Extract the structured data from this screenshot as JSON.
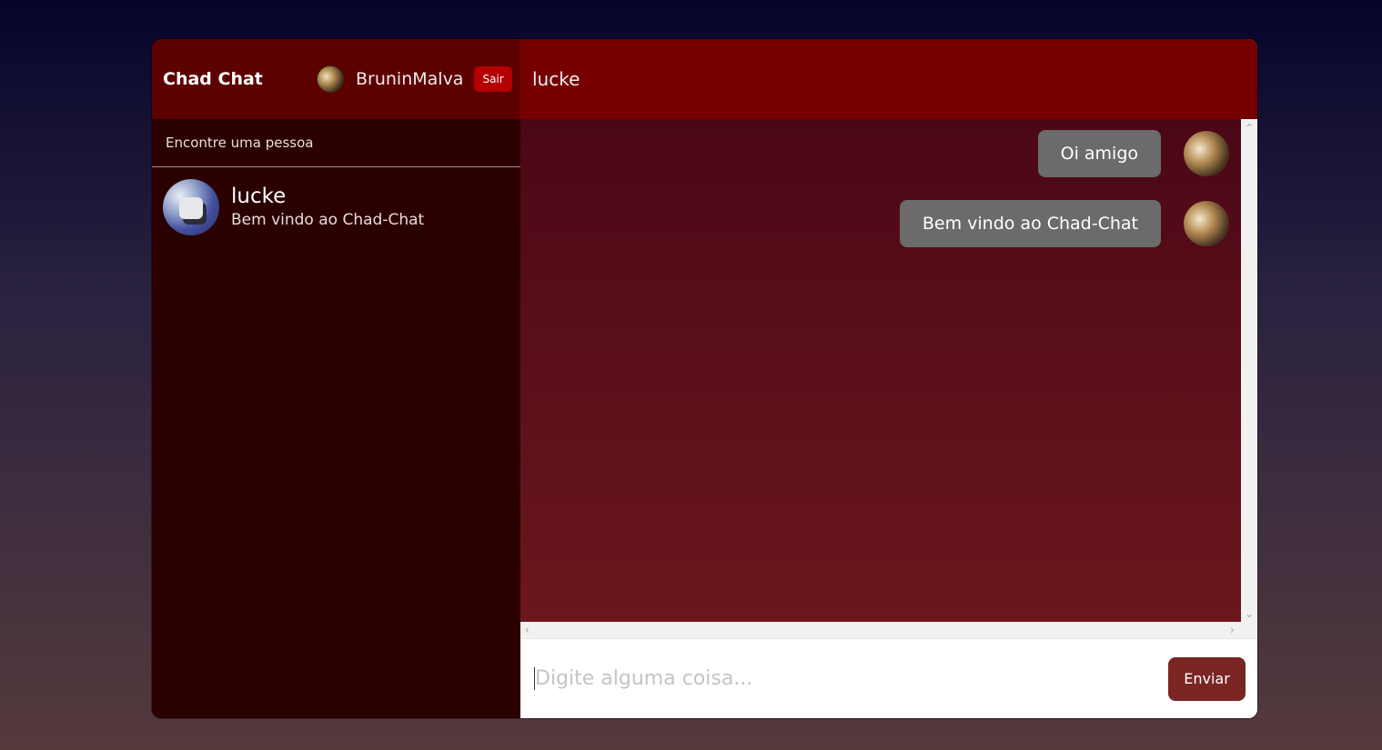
{
  "sidebar": {
    "brand": "Chad Chat",
    "user_name": "BruninMalva",
    "logout_label": "Sair",
    "search_placeholder": "Encontre uma pessoa",
    "contacts": [
      {
        "name": "lucke",
        "last_message": "Bem vindo ao Chad-Chat"
      }
    ]
  },
  "chat": {
    "title": "lucke",
    "messages": [
      {
        "text": "Oi amigo"
      },
      {
        "text": "Bem vindo ao Chad-Chat"
      }
    ],
    "input_placeholder": "Digite alguma coisa...",
    "send_label": "Enviar"
  }
}
